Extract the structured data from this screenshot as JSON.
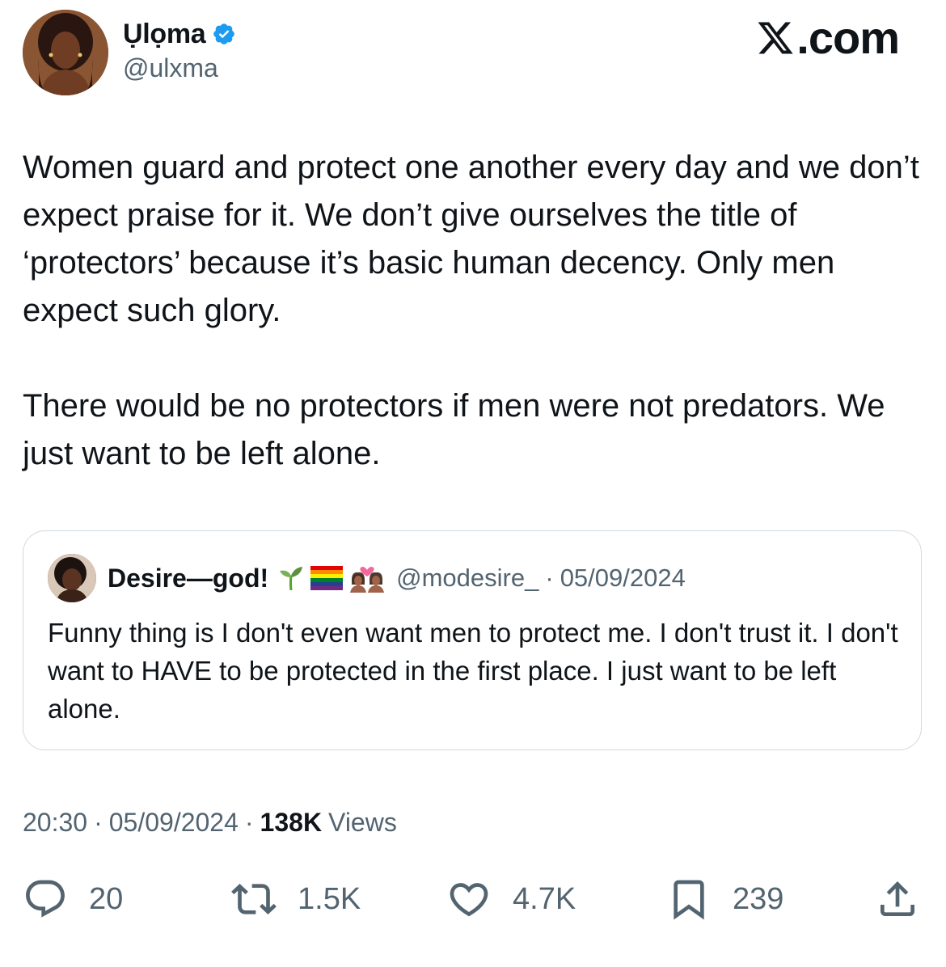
{
  "author": {
    "display_name": "Ụlọma",
    "handle": "@ulxma",
    "verified": true,
    "avatar_icon": "profile-photo"
  },
  "brand": {
    "logo_text": ".com",
    "logo_icon": "x-logo-icon"
  },
  "tweet": {
    "paragraphs": [
      "Women guard and protect one another every day and we don’t expect praise for it. We don’t give ourselves the title of ‘protectors’ because it’s basic human decency. Only men expect such glory.",
      "There would be no protectors if men were not predators. We just want to be left alone."
    ]
  },
  "quote": {
    "display_name": "Desire—god!",
    "emojis": [
      "seedling-emoji",
      "rainbow-flag-emoji",
      "two-women-heart-emoji"
    ],
    "handle": "@modesire_",
    "separator": "·",
    "date": "05/09/2024",
    "text": "Funny thing is I don't even want men to protect me. I don't trust it. I don't want to HAVE to be protected in the first place. I just want to be left alone."
  },
  "meta": {
    "time": "20:30",
    "separator": "·",
    "date": "05/09/2024",
    "views_count": "138K",
    "views_label": "Views"
  },
  "actions": {
    "replies": "20",
    "reposts": "1.5K",
    "likes": "4.7K",
    "bookmarks": "239"
  },
  "colors": {
    "text": "#0f1419",
    "secondary": "#536471",
    "border": "#cfd9de",
    "verified": "#1d9bf0"
  }
}
